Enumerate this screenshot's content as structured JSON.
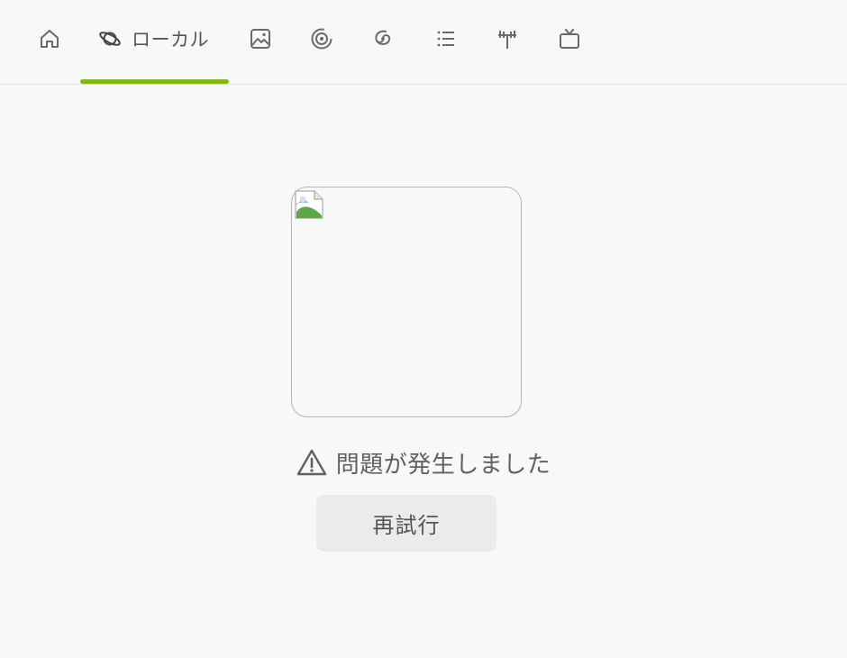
{
  "tabs": [
    {
      "icon": "home-icon",
      "label": ""
    },
    {
      "icon": "planet-icon",
      "label": "ローカル",
      "active": true
    },
    {
      "icon": "image-icon",
      "label": ""
    },
    {
      "icon": "spiral-icon",
      "label": ""
    },
    {
      "icon": "galaxy-icon",
      "label": ""
    },
    {
      "icon": "list-icon",
      "label": ""
    },
    {
      "icon": "antenna-icon",
      "label": ""
    },
    {
      "icon": "tv-icon",
      "label": ""
    }
  ],
  "colors": {
    "accent": "#84b817",
    "background": "#f8f8f8",
    "button_bg": "#ebebeb",
    "text": "#616161"
  },
  "error": {
    "icon": "warning-icon",
    "message": "問題が発生しました"
  },
  "retry": {
    "label": "再試行"
  },
  "image": {
    "icon": "broken-image-icon"
  }
}
